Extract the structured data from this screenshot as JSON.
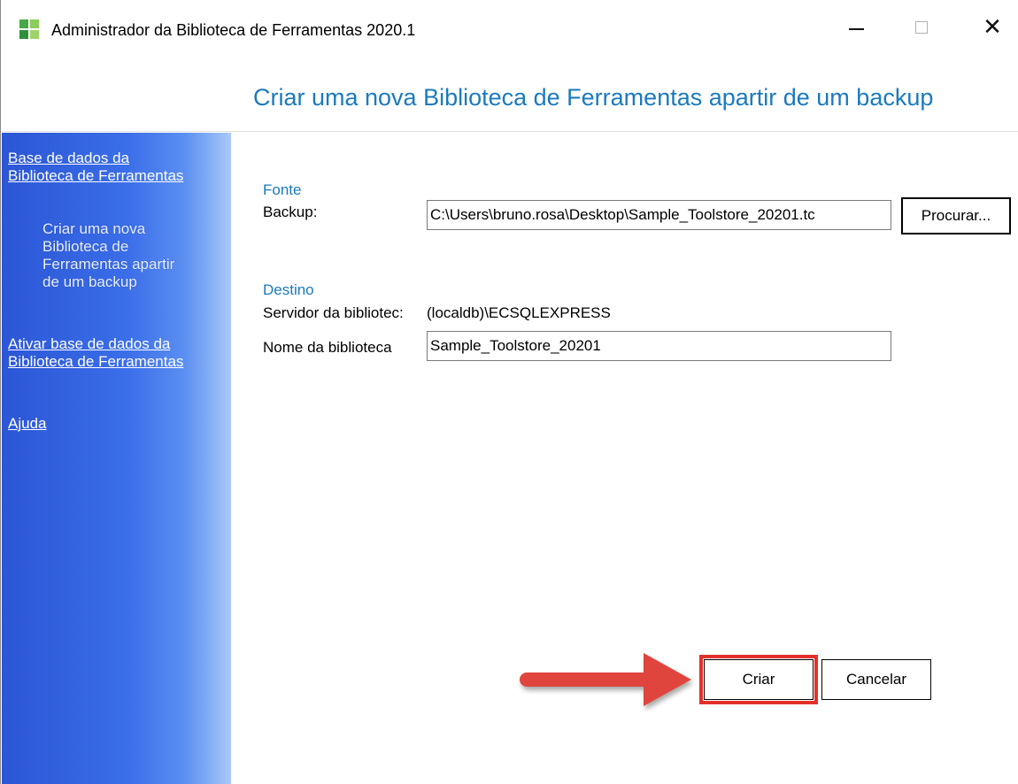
{
  "window": {
    "title": "Administrador da Biblioteca de Ferramentas 2020.1",
    "controls": {
      "minimize": "—",
      "maximize": "□",
      "close": "✕"
    }
  },
  "header": {
    "title": "Criar uma nova Biblioteca de Ferramentas apartir de um backup"
  },
  "sidebar": {
    "items": [
      {
        "label": "Base de dados da Biblioteca de Ferramentas",
        "type": "link"
      },
      {
        "label": "Criar uma nova Biblioteca de Ferramentas apartir de um backup",
        "type": "current"
      },
      {
        "label": "Ativar base de dados da Biblioteca de Ferramentas",
        "type": "link"
      },
      {
        "label": "Ajuda",
        "type": "link"
      }
    ]
  },
  "form": {
    "source": {
      "group_label": "Fonte",
      "backup_label": "Backup:",
      "backup_value": "C:\\Users\\bruno.rosa\\Desktop\\Sample_Toolstore_20201.tc",
      "browse_label": "Procurar..."
    },
    "destination": {
      "group_label": "Destino",
      "server_label": "Servidor da bibliotec:",
      "server_value": "(localdb)\\ECSQLEXPRESS",
      "name_label": "Nome da biblioteca",
      "name_value": "Sample_Toolstore_20201"
    }
  },
  "actions": {
    "create_label": "Criar",
    "cancel_label": "Cancelar"
  },
  "colors": {
    "accent": "#1b7abf",
    "sidebar_dark": "#2b56d5",
    "sidebar_light": "#a9c9f8",
    "highlight_red": "#e2312b"
  },
  "icons": {
    "app": "app-grid-icon",
    "annotation": "red-arrow-icon"
  }
}
